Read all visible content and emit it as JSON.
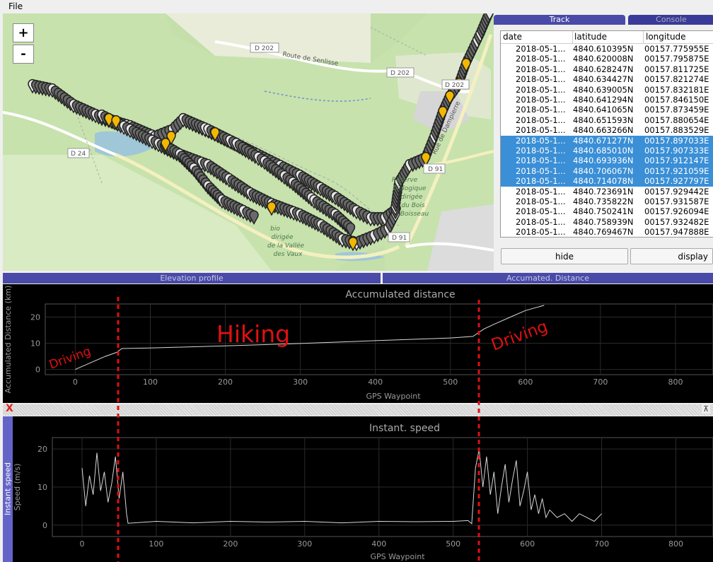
{
  "menu": {
    "file": "File"
  },
  "map": {
    "zoom_in": "+",
    "zoom_out": "-",
    "labels": {
      "d202_a": "D 202",
      "road_senlisse": "Route de Senlisse",
      "d202_b": "D 202",
      "d202_c": "D 202",
      "d24": "D 24",
      "d91_a": "D 91",
      "d91_b": "D 91",
      "rue_dampierre": "Rue de Dampierre",
      "reserve": [
        "Réserve",
        "biologique",
        "dirigée",
        "du Bois",
        "Boisseau"
      ],
      "vaux": [
        "bio",
        "dirigée",
        "de la Vallée",
        "des Vaux"
      ]
    }
  },
  "panel": {
    "tab_track": "Track",
    "tab_console": "Console",
    "columns": [
      "date",
      "latitude",
      "longitude"
    ],
    "rows": [
      {
        "date": "2018-05-1...",
        "lat": "4840.610395N",
        "lon": "00157.775955E",
        "selected": false
      },
      {
        "date": "2018-05-1...",
        "lat": "4840.620008N",
        "lon": "00157.795875E",
        "selected": false
      },
      {
        "date": "2018-05-1...",
        "lat": "4840.628247N",
        "lon": "00157.811725E",
        "selected": false
      },
      {
        "date": "2018-05-1...",
        "lat": "4840.634427N",
        "lon": "00157.821274E",
        "selected": false
      },
      {
        "date": "2018-05-1...",
        "lat": "4840.639005N",
        "lon": "00157.832181E",
        "selected": false
      },
      {
        "date": "2018-05-1...",
        "lat": "4840.641294N",
        "lon": "00157.846150E",
        "selected": false
      },
      {
        "date": "2018-05-1...",
        "lat": "4840.641065N",
        "lon": "00157.873459E",
        "selected": false
      },
      {
        "date": "2018-05-1...",
        "lat": "4840.651593N",
        "lon": "00157.880654E",
        "selected": false
      },
      {
        "date": "2018-05-1...",
        "lat": "4840.663266N",
        "lon": "00157.883529E",
        "selected": false
      },
      {
        "date": "2018-05-1...",
        "lat": "4840.671277N",
        "lon": "00157.897033E",
        "selected": true
      },
      {
        "date": "2018-05-1...",
        "lat": "4840.685010N",
        "lon": "00157.907333E",
        "selected": true
      },
      {
        "date": "2018-05-1...",
        "lat": "4840.693936N",
        "lon": "00157.912147E",
        "selected": true
      },
      {
        "date": "2018-05-1...",
        "lat": "4840.706067N",
        "lon": "00157.921059E",
        "selected": true
      },
      {
        "date": "2018-05-1...",
        "lat": "4840.714078N",
        "lon": "00157.927797E",
        "selected": true
      },
      {
        "date": "2018-05-1...",
        "lat": "4840.723691N",
        "lon": "00157.929442E",
        "selected": false
      },
      {
        "date": "2018-05-1...",
        "lat": "4840.735822N",
        "lon": "00157.931587E",
        "selected": false
      },
      {
        "date": "2018-05-1...",
        "lat": "4840.750241N",
        "lon": "00157.926094E",
        "selected": false
      },
      {
        "date": "2018-05-1...",
        "lat": "4840.758939N",
        "lon": "00157.932482E",
        "selected": false
      },
      {
        "date": "2018-05-1...",
        "lat": "4840.769467N",
        "lon": "00157.947888E",
        "selected": false
      }
    ],
    "hide_label": "hide",
    "display_label": "display"
  },
  "lower_tabs": {
    "elevation": "Elevation profile",
    "distance": "Accumated. Distance"
  },
  "sidebar": {
    "close_glyph": "X",
    "maximize_glyph": "⊼",
    "title": "Instant speed"
  },
  "annotations": {
    "driving1": "Driving",
    "hiking": "Hiking",
    "driving2": "Driving"
  },
  "colors": {
    "selection": "#3a8fd6",
    "tab": "#4a4aa8",
    "marker_yellow": "#f2b800",
    "marker_gray": "#9a9a9a",
    "dashed_line": "#e01010"
  },
  "chart_data": [
    {
      "type": "line",
      "title": "Accumulated distance",
      "xlabel": "GPS Waypoint",
      "ylabel": "Accumulated Distance (km)",
      "xlim": [
        -40,
        850
      ],
      "ylim": [
        -2,
        25
      ],
      "xticks": [
        0,
        100,
        200,
        300,
        400,
        500,
        600,
        700,
        800
      ],
      "yticks": [
        0,
        10,
        20
      ],
      "grid": true,
      "x": [
        0,
        20,
        40,
        55,
        62,
        100,
        200,
        300,
        400,
        500,
        530,
        545,
        560,
        580,
        600,
        625
      ],
      "y": [
        0,
        2.5,
        5,
        6.5,
        8,
        8.2,
        9,
        9.9,
        11,
        12,
        12.6,
        15.5,
        17.5,
        20,
        22.5,
        24.5
      ]
    },
    {
      "type": "line",
      "title": "Instant. speed",
      "xlabel": "GPS Waypoint",
      "ylabel": "Speed (m/s)",
      "xlim": [
        -40,
        850
      ],
      "ylim": [
        -3,
        23
      ],
      "xticks": [
        0,
        100,
        200,
        300,
        400,
        500,
        600,
        700,
        800
      ],
      "yticks": [
        0,
        10,
        20
      ],
      "grid": true,
      "x": [
        0,
        5,
        10,
        15,
        20,
        25,
        30,
        35,
        40,
        45,
        50,
        55,
        60,
        62,
        100,
        150,
        200,
        250,
        300,
        350,
        400,
        450,
        500,
        520,
        525,
        530,
        535,
        540,
        545,
        550,
        555,
        560,
        565,
        570,
        575,
        580,
        585,
        590,
        595,
        600,
        605,
        610,
        615,
        620,
        625,
        630,
        640,
        650,
        660,
        670,
        680,
        690,
        700
      ],
      "y": [
        15,
        5,
        13,
        8,
        19,
        9,
        14,
        6,
        11,
        18,
        7,
        14,
        3,
        0.5,
        1,
        0.6,
        1,
        0.8,
        1,
        0.6,
        1,
        0.9,
        1,
        1.2,
        0.4,
        15,
        20,
        10,
        18,
        8,
        14,
        3,
        10,
        16,
        6,
        12,
        17,
        5,
        9,
        14,
        4,
        8,
        3,
        7,
        2,
        4,
        2,
        3,
        1,
        3,
        2,
        1,
        3
      ]
    }
  ]
}
